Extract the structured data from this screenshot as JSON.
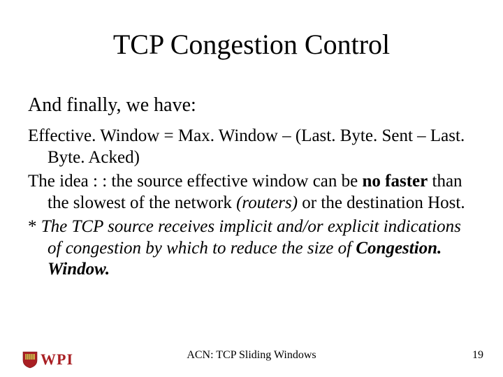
{
  "title": "TCP Congestion Control",
  "subtitle": "And finally, we have:",
  "body": {
    "line1_a": "Effective. Window = Max. Window – (Last. Byte. Sent – ",
    "line1_b": "Last. Byte. Acked)",
    "line2_a": "The idea : : the source effective window can be ",
    "line2_b": "no faster",
    "line2_c": " than the slowest of the network ",
    "line2_d": "(routers)",
    "line2_e": " or the destination Host.",
    "line3_a": "* ",
    "line3_b": "The TCP source receives implicit  and/or explicit indications  of congestion by which to reduce  the size of ",
    "line3_c": "Congestion. Window."
  },
  "footer": {
    "center": "ACN: TCP Sliding Windows",
    "page": "19"
  },
  "logo": {
    "text": "WPI"
  }
}
